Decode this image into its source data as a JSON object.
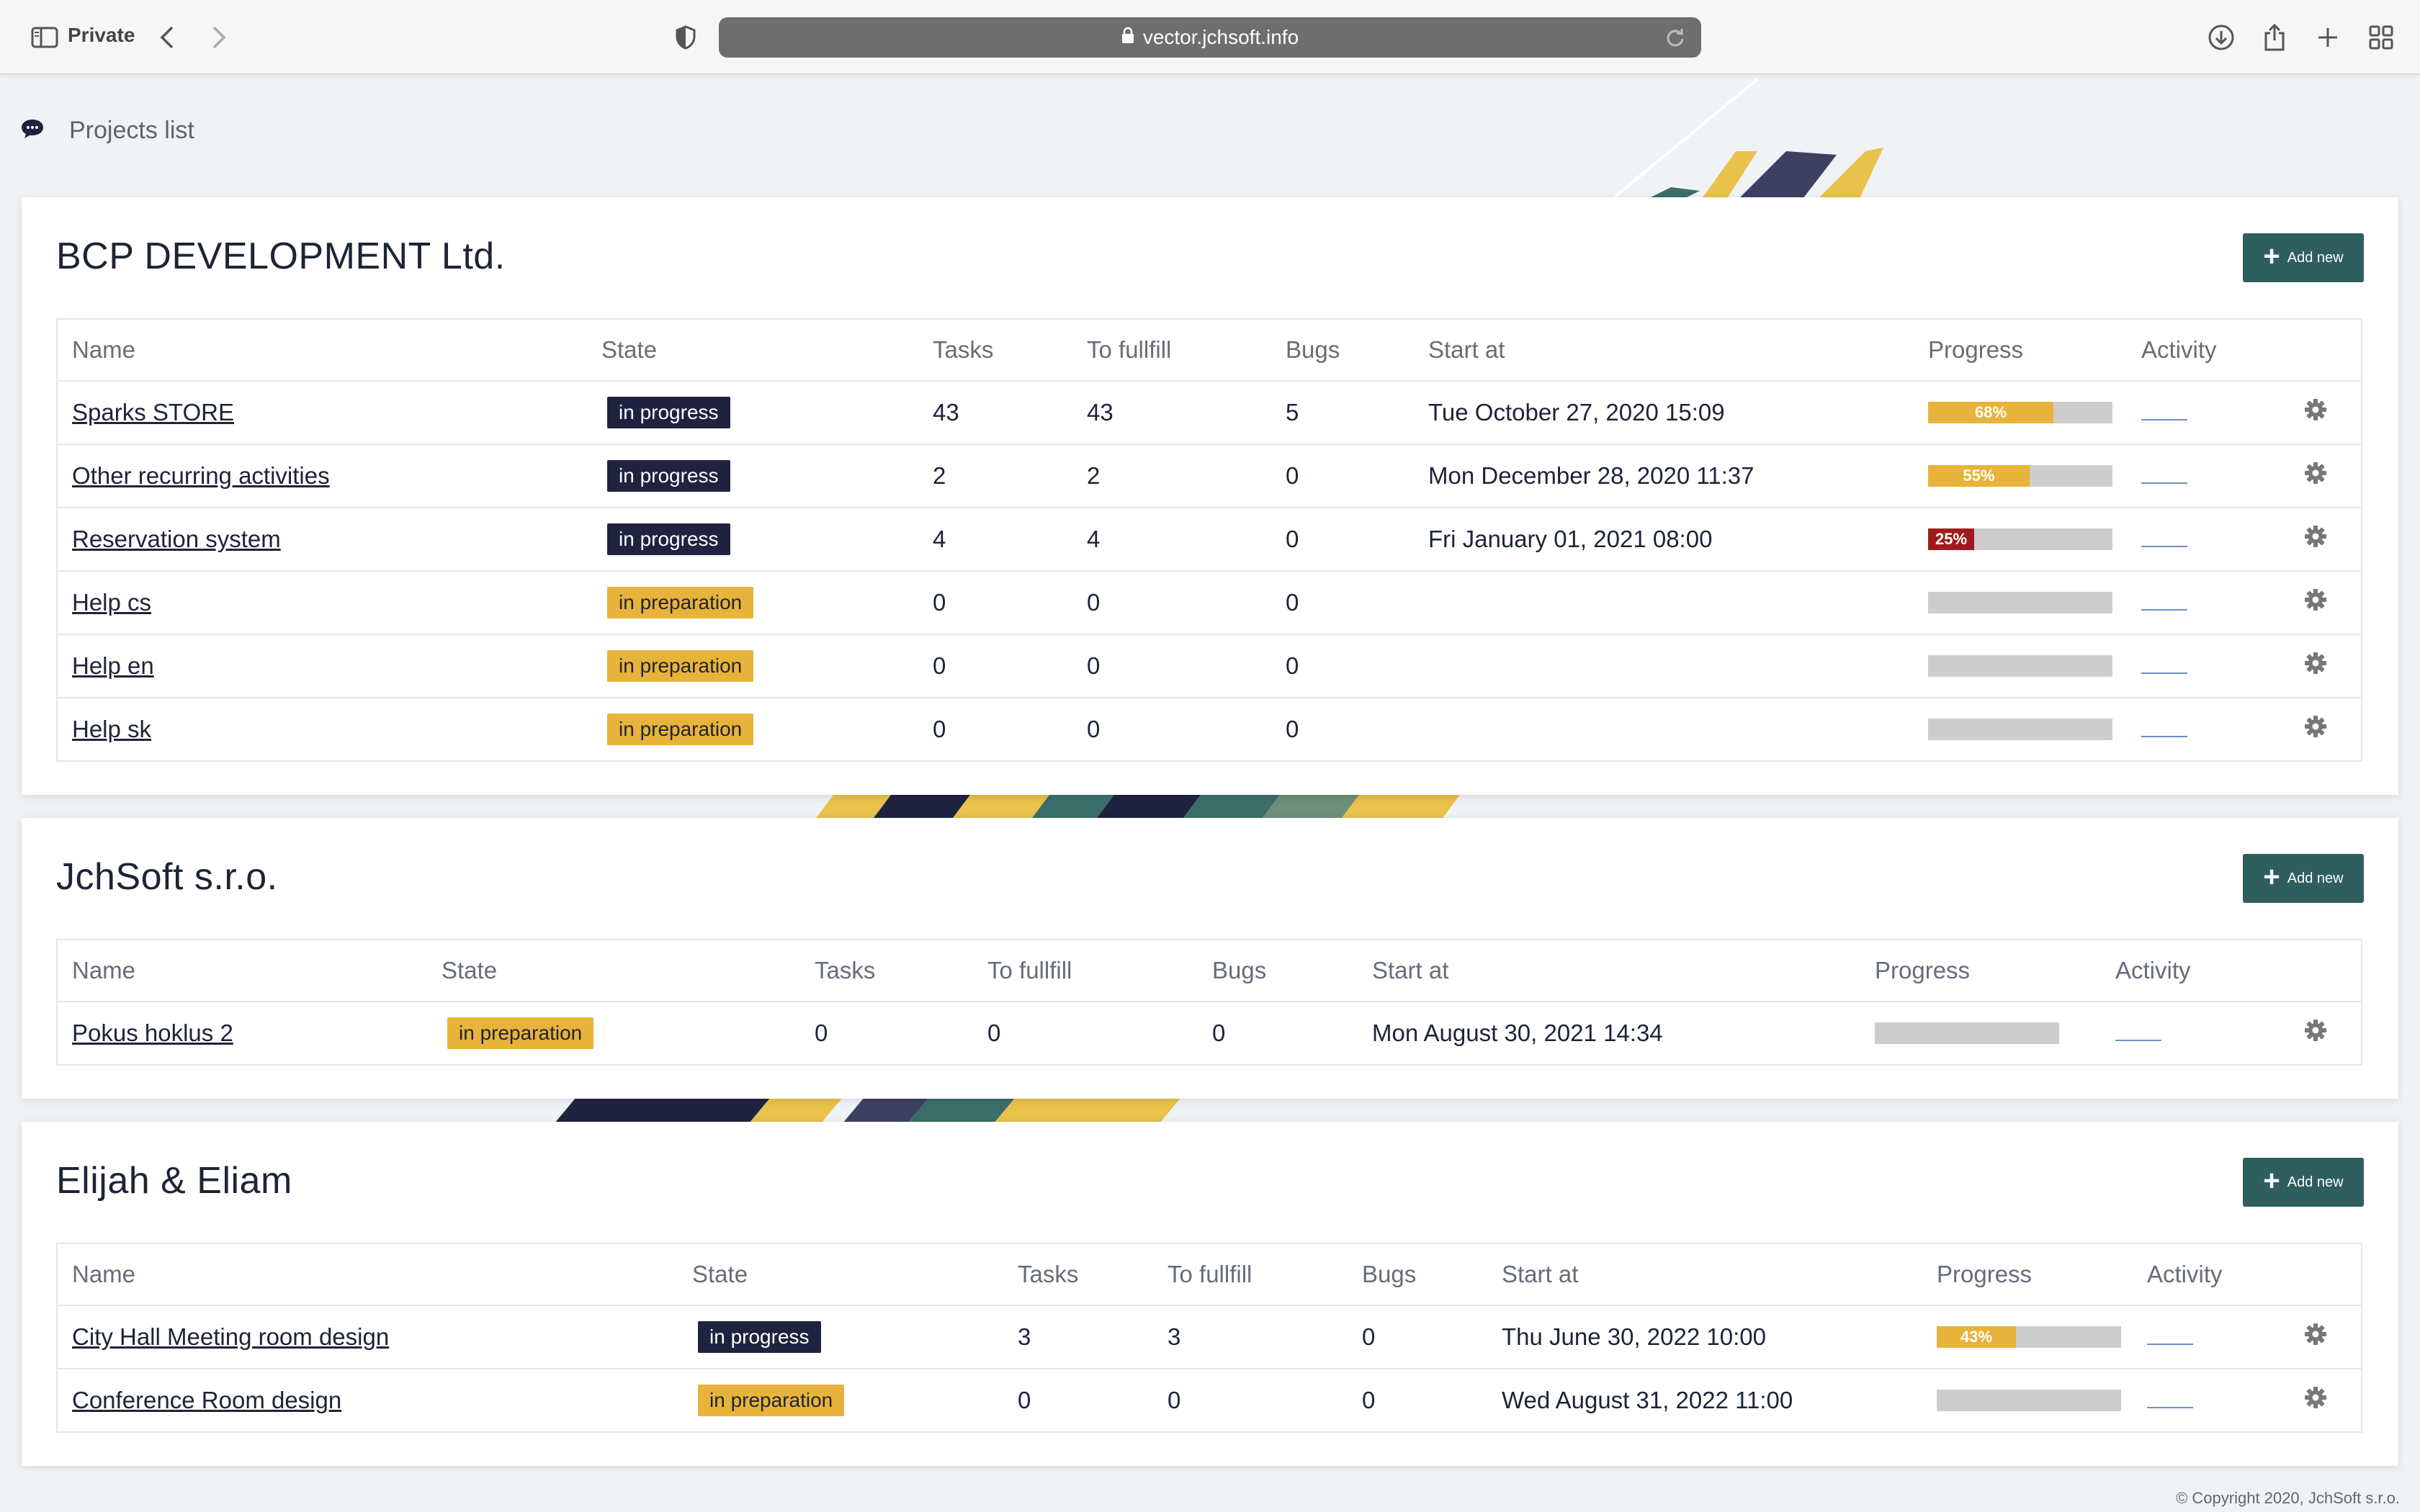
{
  "browser": {
    "private_label": "Private",
    "url": "vector.jchsoft.info"
  },
  "page": {
    "title": "Projects list"
  },
  "table_headers": {
    "name": "Name",
    "state": "State",
    "tasks": "Tasks",
    "to_fulfill": "To fullfill",
    "bugs": "Bugs",
    "start_at": "Start at",
    "progress": "Progress",
    "activity": "Activity"
  },
  "add_label": "Add new",
  "colors": {
    "in_progress": "#1f2340",
    "in_preparation": "#e8b33a",
    "progress_ok": "#e8b33a",
    "progress_low": "#a01c1c",
    "add_button": "#2f5e5e"
  },
  "clients": [
    {
      "name": "BCP DEVELOPMENT Ltd.",
      "projects": [
        {
          "name": "Sparks STORE",
          "state": "in progress",
          "tasks": "43",
          "to_fulfill": "43",
          "bugs": "5",
          "start_at": "Tue October 27, 2020 15:09",
          "progress": 68,
          "progress_label": "68%"
        },
        {
          "name": "Other recurring activities",
          "state": "in progress",
          "tasks": "2",
          "to_fulfill": "2",
          "bugs": "0",
          "start_at": "Mon December 28, 2020 11:37",
          "progress": 55,
          "progress_label": "55%"
        },
        {
          "name": "Reservation system",
          "state": "in progress",
          "tasks": "4",
          "to_fulfill": "4",
          "bugs": "0",
          "start_at": "Fri January 01, 2021 08:00",
          "progress": 25,
          "progress_label": "25%"
        },
        {
          "name": "Help cs",
          "state": "in preparation",
          "tasks": "0",
          "to_fulfill": "0",
          "bugs": "0",
          "start_at": "",
          "progress": 0,
          "progress_label": ""
        },
        {
          "name": "Help en",
          "state": "in preparation",
          "tasks": "0",
          "to_fulfill": "0",
          "bugs": "0",
          "start_at": "",
          "progress": 0,
          "progress_label": ""
        },
        {
          "name": "Help sk",
          "state": "in preparation",
          "tasks": "0",
          "to_fulfill": "0",
          "bugs": "0",
          "start_at": "",
          "progress": 0,
          "progress_label": ""
        }
      ]
    },
    {
      "name": "JchSoft s.r.o.",
      "projects": [
        {
          "name": "Pokus hoklus 2",
          "state": "in preparation",
          "tasks": "0",
          "to_fulfill": "0",
          "bugs": "0",
          "start_at": "Mon August 30, 2021 14:34",
          "progress": 0,
          "progress_label": ""
        }
      ]
    },
    {
      "name": "Elijah & Eliam",
      "projects": [
        {
          "name": "City Hall Meeting room design",
          "state": "in progress",
          "tasks": "3",
          "to_fulfill": "3",
          "bugs": "0",
          "start_at": "Thu June 30, 2022 10:00",
          "progress": 43,
          "progress_label": "43%"
        },
        {
          "name": "Conference Room design",
          "state": "in preparation",
          "tasks": "0",
          "to_fulfill": "0",
          "bugs": "0",
          "start_at": "Wed August 31, 2022 11:00",
          "progress": 0,
          "progress_label": ""
        }
      ]
    }
  ],
  "footer": {
    "copyright": "© Copyright 2020, JchSoft s.r.o."
  }
}
